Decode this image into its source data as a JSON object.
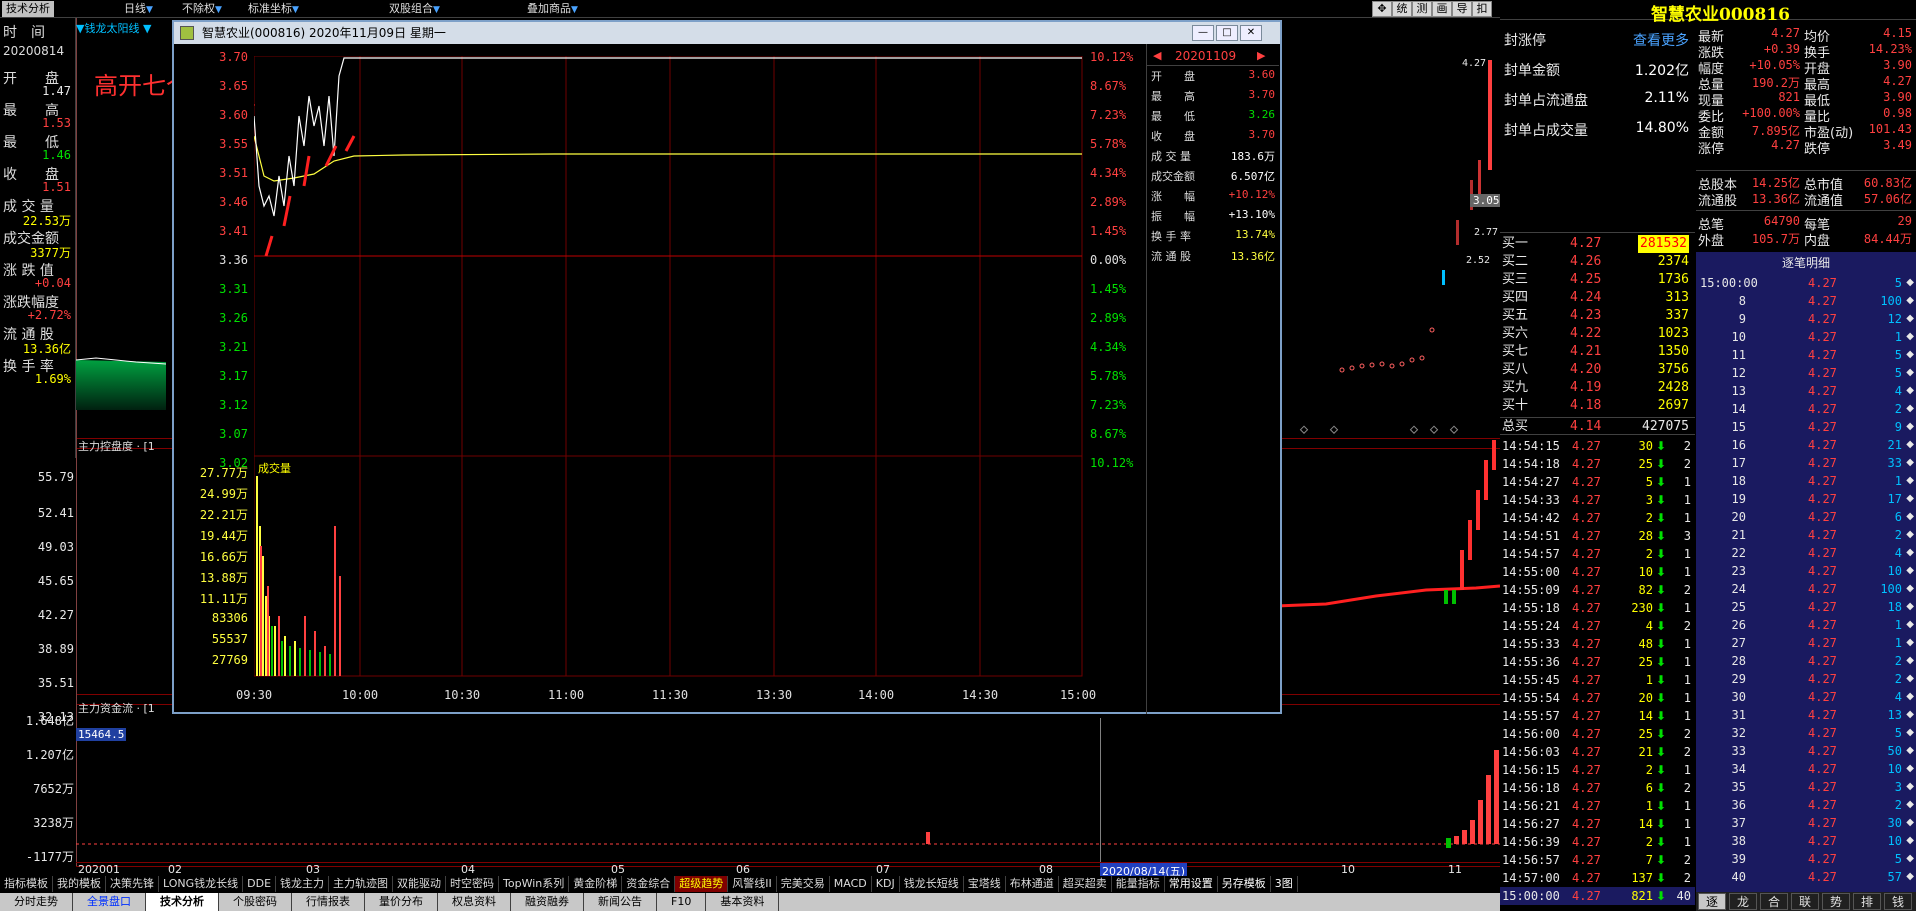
{
  "topbar": {
    "tabs": [
      "技术分析"
    ],
    "dropdowns": [
      "日线",
      "不除权",
      "标准坐标",
      "双股组合",
      "叠加商品"
    ],
    "icons": [
      "统",
      "测",
      "画",
      "导",
      "扣"
    ]
  },
  "left_panel": {
    "date_label": "时　间",
    "date": "20200814",
    "rows": [
      {
        "label": "开　　盘",
        "value": "1.47"
      },
      {
        "label": "最　　高",
        "value": "1.53"
      },
      {
        "label": "最　　低",
        "value": "1.46"
      },
      {
        "label": "收　　盘",
        "value": "1.51"
      },
      {
        "label": "成 交 量",
        "value": "22.53万"
      },
      {
        "label": "成交金额",
        "value": "3377万"
      },
      {
        "label": "涨 跌 值",
        "value": "+0.04"
      },
      {
        "label": "涨跌幅度",
        "value": "+2.72%"
      },
      {
        "label": "流 通 股",
        "value": "13.36亿"
      },
      {
        "label": "换 手 率",
        "value": "1.69%"
      }
    ]
  },
  "main_chart": {
    "indicator_title": "▼钱龙太阳线 ▼",
    "annotation": "高开七个多点",
    "mid_indicator_title": "主力控盘度 · [1",
    "mid_axis": [
      "55.79",
      "52.41",
      "49.03",
      "45.65",
      "42.27",
      "38.89",
      "35.51",
      "32.13"
    ],
    "low_indicator_title": "主力资金流 · [1",
    "low_value_label": "15464.5",
    "low_axis": [
      "1.648亿",
      "1.207亿",
      "7652万",
      "3238万",
      "-1177万"
    ],
    "x_labels": [
      "202001",
      "02",
      "03",
      "04",
      "05",
      "06",
      "07",
      "08",
      "10",
      "11"
    ],
    "highlight_date": "2020/08/14(五)"
  },
  "popup": {
    "title": "智慧农业(000816)   2020年11月09日  星期一",
    "date_nav": "20201109",
    "price_axis": [
      "3.70",
      "3.65",
      "3.60",
      "3.55",
      "3.51",
      "3.46",
      "3.41",
      "3.36",
      "3.31",
      "3.26",
      "3.21",
      "3.17",
      "3.12",
      "3.07",
      "3.02"
    ],
    "pct_axis": [
      "10.12%",
      "8.67%",
      "7.23%",
      "5.78%",
      "4.34%",
      "2.89%",
      "1.45%",
      "0.00%",
      "1.45%",
      "2.89%",
      "4.34%",
      "5.78%",
      "7.23%",
      "8.67%",
      "10.12%"
    ],
    "vol_label": "成交量",
    "vol_axis": [
      "27.77万",
      "24.99万",
      "22.21万",
      "19.44万",
      "16.66万",
      "13.88万",
      "11.11万",
      "83306",
      "55537",
      "27769"
    ],
    "time_axis": [
      "09:30",
      "10:00",
      "10:30",
      "11:00",
      "11:30",
      "13:30",
      "14:00",
      "14:30",
      "15:00"
    ],
    "info": [
      {
        "label": "开　　盘",
        "value": "3.60"
      },
      {
        "label": "最　　高",
        "value": "3.70"
      },
      {
        "label": "最　　低",
        "value": "3.26"
      },
      {
        "label": "收　　盘",
        "value": "3.70"
      },
      {
        "label": "成 交 量",
        "value": "183.6万"
      },
      {
        "label": "成交金额",
        "value": "6.507亿"
      },
      {
        "label": "涨　　幅",
        "value": "+10.12%"
      },
      {
        "label": "振　　幅",
        "value": "+13.10%"
      },
      {
        "label": "换 手 率",
        "value": "13.74%"
      },
      {
        "label": "流 通 股",
        "value": "13.36亿"
      }
    ]
  },
  "right_panel": {
    "stock_name": "智慧农业000816",
    "price_small": [
      "4.27",
      "3.05",
      "2.77",
      "2.52"
    ],
    "seal": [
      {
        "label": "封涨停",
        "value": "查看更多"
      },
      {
        "label": "封单金额",
        "value": "1.202亿"
      },
      {
        "label": "封单占流通盘",
        "value": "2.11%"
      },
      {
        "label": "封单占成交量",
        "value": "14.80%"
      }
    ],
    "stats": [
      [
        "最新",
        "4.27",
        "均价",
        "4.15"
      ],
      [
        "涨跌",
        "+0.39",
        "换手",
        "14.23%"
      ],
      [
        "幅度",
        "+10.05%",
        "开盘",
        "3.90"
      ],
      [
        "总量",
        "190.2万",
        "最高",
        "4.27"
      ],
      [
        "现量",
        "821",
        "最低",
        "3.90"
      ],
      [
        "委比",
        "+100.00%",
        "量比",
        "0.98"
      ],
      [
        "金额",
        "7.895亿",
        "市盈(动)",
        "101.43"
      ],
      [
        "涨停",
        "4.27",
        "跌停",
        "3.49"
      ]
    ],
    "stats2": [
      [
        "总股本",
        "14.25亿",
        "总市值",
        "60.83亿"
      ],
      [
        "流通股",
        "13.36亿",
        "流通值",
        "57.06亿"
      ]
    ],
    "stats3": [
      [
        "总笔",
        "64790",
        "每笔",
        "29"
      ],
      [
        "外盘",
        "105.7万",
        "内盘",
        "84.44万"
      ]
    ],
    "bids": [
      [
        "买一",
        "4.27",
        "281532"
      ],
      [
        "买二",
        "4.26",
        "2374"
      ],
      [
        "买三",
        "4.25",
        "1736"
      ],
      [
        "买四",
        "4.24",
        "313"
      ],
      [
        "买五",
        "4.23",
        "337"
      ],
      [
        "买六",
        "4.22",
        "1023"
      ],
      [
        "买七",
        "4.21",
        "1350"
      ],
      [
        "买八",
        "4.20",
        "3756"
      ],
      [
        "买九",
        "4.19",
        "2428"
      ],
      [
        "买十",
        "4.18",
        "2697"
      ]
    ],
    "total_bid": [
      "总买",
      "4.14",
      "427075"
    ],
    "ticks": [
      [
        "14:54:15",
        "4.27",
        "30",
        "2"
      ],
      [
        "14:54:18",
        "4.27",
        "25",
        "2"
      ],
      [
        "14:54:27",
        "4.27",
        "5",
        "1"
      ],
      [
        "14:54:33",
        "4.27",
        "3",
        "1"
      ],
      [
        "14:54:42",
        "4.27",
        "2",
        "1"
      ],
      [
        "14:54:51",
        "4.27",
        "28",
        "3"
      ],
      [
        "14:54:57",
        "4.27",
        "2",
        "1"
      ],
      [
        "14:55:00",
        "4.27",
        "10",
        "1"
      ],
      [
        "14:55:09",
        "4.27",
        "82",
        "2"
      ],
      [
        "14:55:18",
        "4.27",
        "230",
        "1"
      ],
      [
        "14:55:24",
        "4.27",
        "4",
        "2"
      ],
      [
        "14:55:33",
        "4.27",
        "48",
        "1"
      ],
      [
        "14:55:36",
        "4.27",
        "25",
        "1"
      ],
      [
        "14:55:45",
        "4.27",
        "1",
        "1"
      ],
      [
        "14:55:54",
        "4.27",
        "20",
        "1"
      ],
      [
        "14:55:57",
        "4.27",
        "14",
        "1"
      ],
      [
        "14:56:00",
        "4.27",
        "25",
        "2"
      ],
      [
        "14:56:03",
        "4.27",
        "21",
        "2"
      ],
      [
        "14:56:15",
        "4.27",
        "2",
        "1"
      ],
      [
        "14:56:18",
        "4.27",
        "6",
        "2"
      ],
      [
        "14:56:21",
        "4.27",
        "1",
        "1"
      ],
      [
        "14:56:27",
        "4.27",
        "14",
        "1"
      ],
      [
        "14:56:39",
        "4.27",
        "2",
        "1"
      ],
      [
        "14:56:57",
        "4.27",
        "7",
        "2"
      ],
      [
        "14:57:00",
        "4.27",
        "137",
        "2"
      ],
      [
        "15:00:00",
        "4.27",
        "821",
        "40"
      ]
    ],
    "detail_header": "逐笔明细",
    "details": [
      [
        "15:00:00",
        "4.27",
        "5"
      ],
      [
        "8",
        "4.27",
        "100"
      ],
      [
        "9",
        "4.27",
        "12"
      ],
      [
        "10",
        "4.27",
        "1"
      ],
      [
        "11",
        "4.27",
        "5"
      ],
      [
        "12",
        "4.27",
        "5"
      ],
      [
        "13",
        "4.27",
        "4"
      ],
      [
        "14",
        "4.27",
        "2"
      ],
      [
        "15",
        "4.27",
        "9"
      ],
      [
        "16",
        "4.27",
        "21"
      ],
      [
        "17",
        "4.27",
        "33"
      ],
      [
        "18",
        "4.27",
        "1"
      ],
      [
        "19",
        "4.27",
        "17"
      ],
      [
        "20",
        "4.27",
        "6"
      ],
      [
        "21",
        "4.27",
        "2"
      ],
      [
        "22",
        "4.27",
        "4"
      ],
      [
        "23",
        "4.27",
        "10"
      ],
      [
        "24",
        "4.27",
        "100"
      ],
      [
        "25",
        "4.27",
        "18"
      ],
      [
        "26",
        "4.27",
        "1"
      ],
      [
        "27",
        "4.27",
        "1"
      ],
      [
        "28",
        "4.27",
        "2"
      ],
      [
        "29",
        "4.27",
        "2"
      ],
      [
        "30",
        "4.27",
        "4"
      ],
      [
        "31",
        "4.27",
        "13"
      ],
      [
        "32",
        "4.27",
        "5"
      ],
      [
        "33",
        "4.27",
        "50"
      ],
      [
        "34",
        "4.27",
        "10"
      ],
      [
        "35",
        "4.27",
        "3"
      ],
      [
        "36",
        "4.27",
        "2"
      ],
      [
        "37",
        "4.27",
        "30"
      ],
      [
        "38",
        "4.27",
        "10"
      ],
      [
        "39",
        "4.27",
        "5"
      ],
      [
        "40",
        "4.27",
        "57"
      ]
    ],
    "bottom_tabs": [
      "逐",
      "龙",
      "合",
      "联",
      "势",
      "排",
      "钱"
    ]
  },
  "indicator_tabs": [
    "指标模板",
    "我的模板",
    "决策先锋",
    "LONG钱龙长线",
    "DDE",
    "钱龙主力",
    "主力轨迹图",
    "双能驱动",
    "时空密码",
    "TopWin系列",
    "黄金阶梯",
    "资金综合",
    "超级趋势",
    "风警线II",
    "完美交易",
    "MACD",
    "KDJ",
    "钱龙长短线",
    "宝塔线",
    "布林通道",
    "超买超卖",
    "能量指标",
    "常用设置",
    "另存模板",
    "3图"
  ],
  "bottom_tabs": [
    "分时走势",
    "全景盘口",
    "技术分析",
    "个股密码",
    "行情报表",
    "量价分布",
    "权息资料",
    "融资融券",
    "新闻公告",
    "F10",
    "基本资料"
  ],
  "colors": {
    "up": "#ff4040",
    "down": "#00e000",
    "axis": "#800000",
    "title_bar": "#d4dde8"
  }
}
